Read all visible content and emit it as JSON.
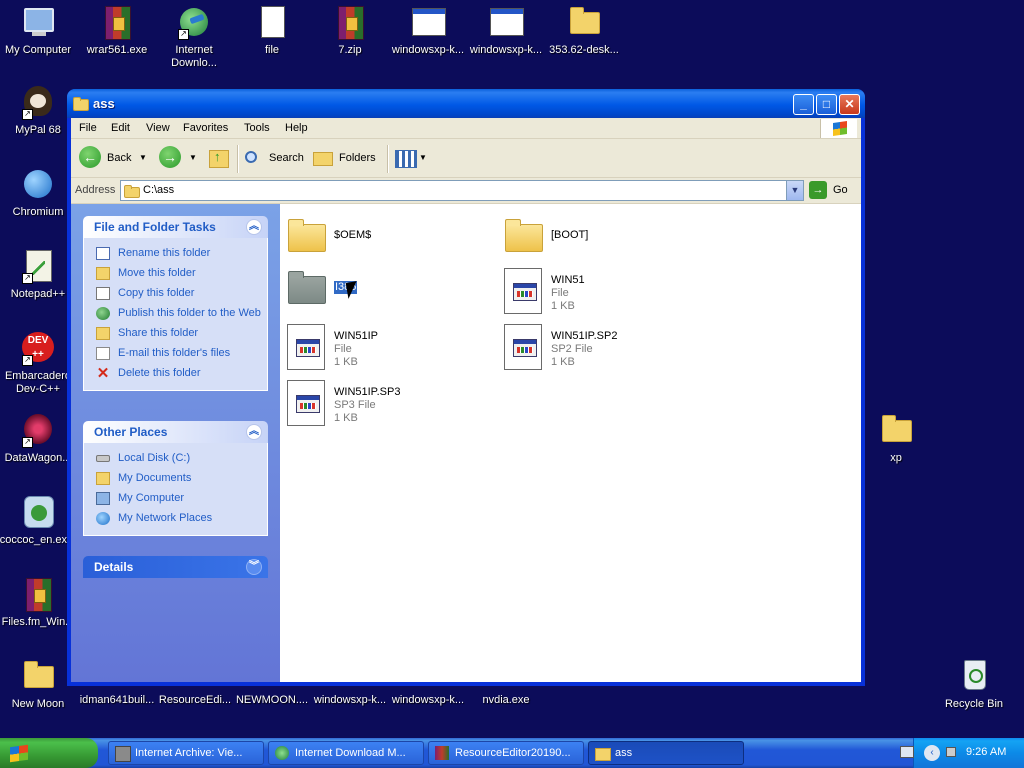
{
  "desktop": {
    "icons": [
      {
        "label": "My Computer"
      },
      {
        "label": "wrar561.exe"
      },
      {
        "label": "Internet Downlo..."
      },
      {
        "label": "file"
      },
      {
        "label": "7.zip"
      },
      {
        "label": "windowsxp-k..."
      },
      {
        "label": "windowsxp-k..."
      },
      {
        "label": "353.62-desk..."
      },
      {
        "label": "MyPal 68"
      },
      {
        "label": "Chromium"
      },
      {
        "label": "Notepad++"
      },
      {
        "label": "Embarcadero Dev-C++"
      },
      {
        "label": "DataWagon..."
      },
      {
        "label": "coccoc_en.ex..."
      },
      {
        "label": "Files.fm_Win..."
      },
      {
        "label": "New Moon"
      },
      {
        "label": "idman641buil..."
      },
      {
        "label": "ResourceEdi..."
      },
      {
        "label": "NEWMOON...."
      },
      {
        "label": "windowsxp-k..."
      },
      {
        "label": "windowsxp-k..."
      },
      {
        "label": "nvdia.exe"
      },
      {
        "label": "xp"
      },
      {
        "label": "Recycle Bin"
      }
    ],
    "dev_icon_text": "DEV\n++"
  },
  "window": {
    "title": "ass",
    "menu": [
      "File",
      "Edit",
      "View",
      "Favorites",
      "Tools",
      "Help"
    ],
    "toolbar": {
      "back_label": "Back",
      "search_label": "Search",
      "folders_label": "Folders"
    },
    "address": {
      "label": "Address",
      "value": "C:\\ass",
      "go_label": "Go"
    },
    "task_pane": {
      "file_folder_tasks": {
        "title": "File and Folder Tasks",
        "items": [
          "Rename this folder",
          "Move this folder",
          "Copy this folder",
          "Publish this folder to the Web",
          "Share this folder",
          "E-mail this folder's files",
          "Delete this folder"
        ]
      },
      "other_places": {
        "title": "Other Places",
        "items": [
          "Local Disk (C:)",
          "My Documents",
          "My Computer",
          "My Network Places"
        ]
      },
      "details": {
        "title": "Details"
      }
    },
    "files": [
      {
        "name": "$OEM$",
        "kind": "folder"
      },
      {
        "name": "[BOOT]",
        "kind": "folder"
      },
      {
        "name": "I386",
        "kind": "folder-selected"
      },
      {
        "name": "WIN51",
        "type": "File",
        "size": "1 KB"
      },
      {
        "name": "WIN51IP",
        "type": "File",
        "size": "1 KB"
      },
      {
        "name": "WIN51IP.SP2",
        "type": "SP2 File",
        "size": "1 KB"
      },
      {
        "name": "WIN51IP.SP3",
        "type": "SP3 File",
        "size": "1 KB"
      }
    ]
  },
  "taskbar": {
    "start_label": "start",
    "tasks": [
      {
        "label": "Internet Archive: Vie..."
      },
      {
        "label": "Internet Download M..."
      },
      {
        "label": "ResourceEditor20190..."
      },
      {
        "label": "ass"
      }
    ],
    "clock": "9:26 AM"
  }
}
